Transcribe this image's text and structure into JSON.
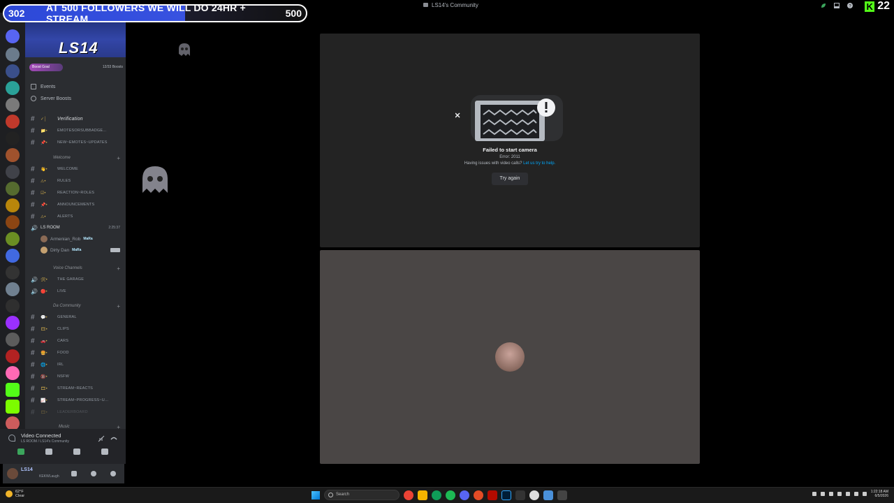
{
  "window": {
    "title": "LS14's Community"
  },
  "kick": {
    "logo_letter": "K",
    "viewer_count": "22"
  },
  "stream_banner": {
    "count": "302",
    "text": "AT 500 FOLLOWERS WE WILL DO 24HR + STREAM",
    "goal": "500"
  },
  "server": {
    "banner_name": "LS14",
    "boost_goal_label": "Boost Goal",
    "boost_count": "12/33 Boosts",
    "events_label": "Events",
    "server_boosts_label": "Server Boosts"
  },
  "channels_top": [
    {
      "emoji": "✓│",
      "name": "Verification",
      "style": "italic"
    },
    {
      "emoji": "📁•",
      "name": "EMOTESORSUBBADGE..."
    },
    {
      "emoji": "📌•",
      "name": "NEW~EMOTES~UPDATES"
    }
  ],
  "categories": {
    "welcome": "Welcome",
    "voice": "Voice Channels",
    "community": "Da Community",
    "music": "Music"
  },
  "channels_welcome": [
    {
      "emoji": "👋•",
      "name": "WELCOME"
    },
    {
      "emoji": "⚠•",
      "name": "RULES"
    },
    {
      "emoji": "☑•",
      "name": "REACTION~ROLES"
    },
    {
      "emoji": "📌•",
      "name": "ANNOUNCEMENTS"
    },
    {
      "emoji": "⚠•",
      "name": "ALERTS"
    }
  ],
  "voice_room": {
    "name": "LS ROOM",
    "time": "2:25:37",
    "users": [
      {
        "name": "Armenian_Rob",
        "tag": "MaRa"
      },
      {
        "name": "Dirty Dan",
        "tag": "MaRa"
      }
    ]
  },
  "channels_voice": [
    {
      "emoji": "🛠•",
      "name": "THE GARAGE"
    },
    {
      "emoji": "🔴•",
      "name": "LIVE"
    }
  ],
  "channels_community": [
    {
      "emoji": "💬•",
      "name": "GENERAL"
    },
    {
      "emoji": "🎞•",
      "name": "CLIPS"
    },
    {
      "emoji": "🚗•",
      "name": "CARS"
    },
    {
      "emoji": "🍔•",
      "name": "FOOD"
    },
    {
      "emoji": "🌐•",
      "name": "IRL"
    },
    {
      "emoji": "🔞•",
      "name": "NSFW"
    },
    {
      "emoji": "🎞•",
      "name": "STREAM~REACTS"
    },
    {
      "emoji": "📈•",
      "name": "STREAM~PROGRESS~U..."
    },
    {
      "emoji": "🎞•",
      "name": "LEADERBOARD"
    }
  ],
  "voice_panel": {
    "status": "Video Connected",
    "location": "LS ROOM / LS14's Community"
  },
  "user_panel": {
    "name": "LS14",
    "status": "KEKWLaugh"
  },
  "stage": {
    "error_title": "Failed to start camera",
    "error_code": "Error: 2011",
    "help_text": "Having issues with video calls?",
    "help_link": "Let us try to help.",
    "try_again": "Try again"
  },
  "taskbar": {
    "temperature": "62°F",
    "condition": "Clear",
    "search_placeholder": "Search",
    "time": "1:22:18 AM",
    "date": "6/5/2026"
  },
  "colors": {
    "accent_link": "#00a8fc",
    "kick_green": "#53fc18",
    "banner_blue": "#3852e0"
  }
}
